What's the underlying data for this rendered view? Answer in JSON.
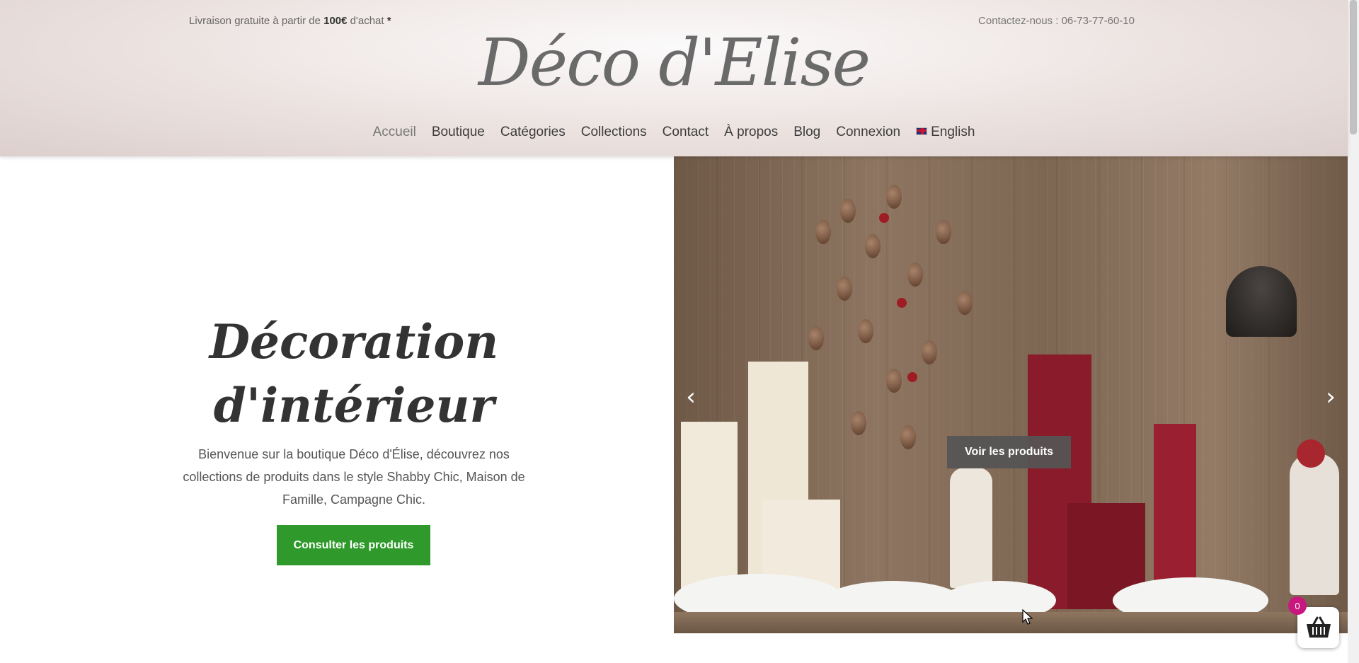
{
  "topbar": {
    "shipping_prefix": "Livraison gratuite à partir de ",
    "shipping_amount": "100€",
    "shipping_suffix": " d'achat ",
    "shipping_asterisk": "*",
    "contact": "Contactez-nous : 06-73-77-60-10"
  },
  "brand": {
    "logo_text": "Déco d'Elise"
  },
  "nav": {
    "items": [
      {
        "label": "Accueil"
      },
      {
        "label": "Boutique"
      },
      {
        "label": "Catégories"
      },
      {
        "label": "Collections"
      },
      {
        "label": "Contact"
      },
      {
        "label": "À propos"
      },
      {
        "label": "Blog"
      },
      {
        "label": "Connexion"
      },
      {
        "label": "English"
      }
    ],
    "active": "Accueil"
  },
  "hero": {
    "title_line1": "Décoration",
    "title_line2": "d'intérieur",
    "description": "Bienvenue sur la boutique Déco d'Élise, découvrez nos collections de produits dans le style Shabby Chic, Maison de Famille, Campagne Chic.",
    "cta_label": "Consulter les produits"
  },
  "slider": {
    "cta_label": "Voir les produits",
    "prev_icon": "chevron-left-icon",
    "next_icon": "chevron-right-icon",
    "prev_glyph": "‹",
    "next_glyph": "›"
  },
  "cart": {
    "count": "0",
    "icon": "basket-icon"
  },
  "colors": {
    "cta_green": "#2f9a2b",
    "badge_pink": "#c8177d",
    "slider_button": "#555555"
  }
}
